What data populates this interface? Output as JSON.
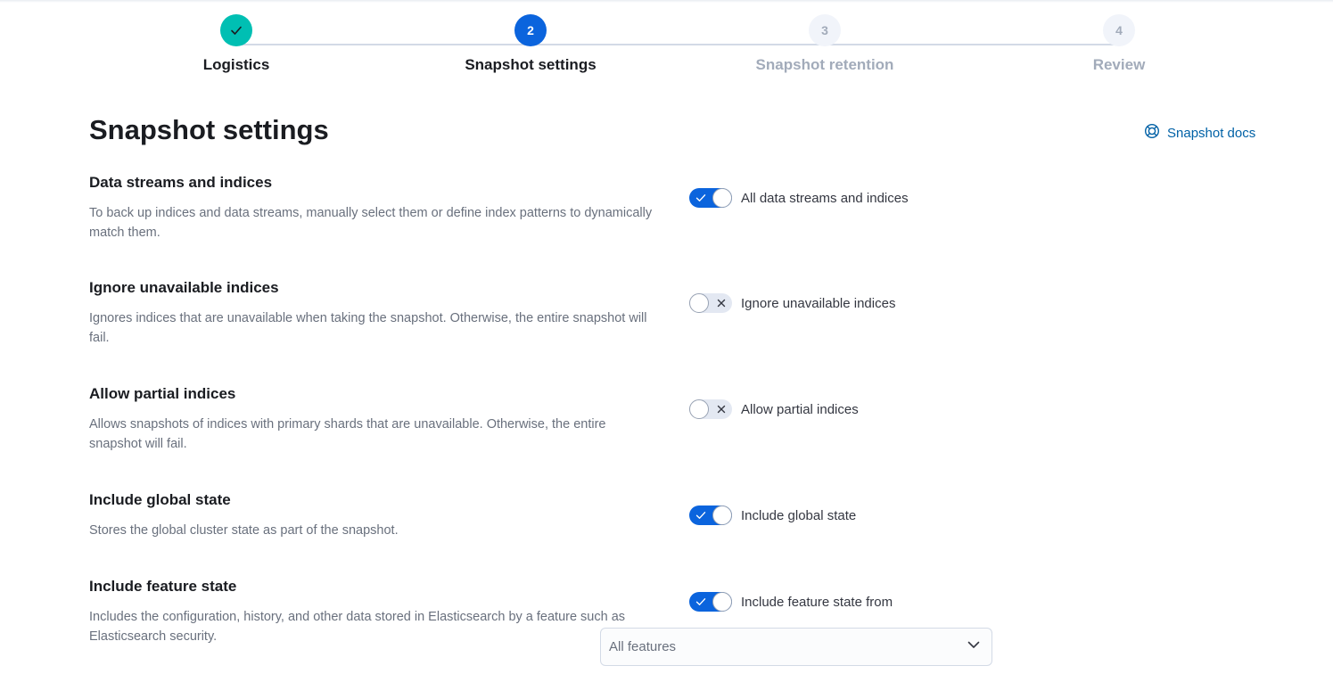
{
  "steps": [
    {
      "number": "1",
      "title": "Logistics",
      "status": "complete"
    },
    {
      "number": "2",
      "title": "Snapshot settings",
      "status": "current"
    },
    {
      "number": "3",
      "title": "Snapshot retention",
      "status": "disabled"
    },
    {
      "number": "4",
      "title": "Review",
      "status": "disabled"
    }
  ],
  "header": {
    "title": "Snapshot settings",
    "docs_link": "Snapshot docs"
  },
  "sections": [
    {
      "title": "Data streams and indices",
      "description": "To back up indices and data streams, manually select them or define index patterns to dynamically match them.",
      "toggle_label": "All data streams and indices",
      "toggle_on": true
    },
    {
      "title": "Ignore unavailable indices",
      "description": "Ignores indices that are unavailable when taking the snapshot. Otherwise, the entire snapshot will fail.",
      "toggle_label": "Ignore unavailable indices",
      "toggle_on": false
    },
    {
      "title": "Allow partial indices",
      "description": "Allows snapshots of indices with primary shards that are unavailable. Otherwise, the entire snapshot will fail.",
      "toggle_label": "Allow partial indices",
      "toggle_on": false
    },
    {
      "title": "Include global state",
      "description": "Stores the global cluster state as part of the snapshot.",
      "toggle_label": "Include global state",
      "toggle_on": true
    },
    {
      "title": "Include feature state",
      "description": "Includes the configuration, history, and other data stored in Elasticsearch by a feature such as Elasticsearch security.",
      "toggle_label": "Include feature state from",
      "toggle_on": true
    }
  ],
  "feature_select": {
    "value": "All features"
  },
  "colors": {
    "primary": "#0b64dd",
    "success": "#00bfb3",
    "link": "#0061a6",
    "subdued_text": "#69707d"
  }
}
